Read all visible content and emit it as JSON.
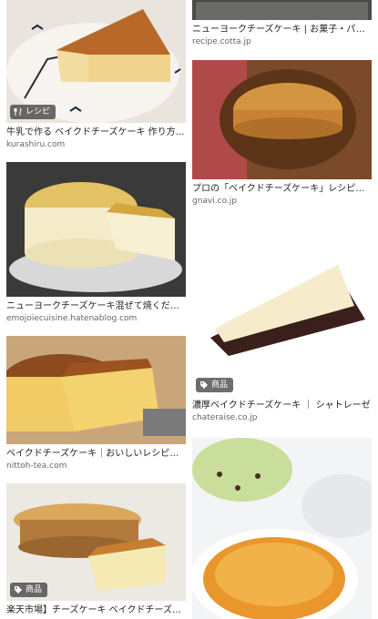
{
  "results": {
    "left": [
      {
        "title": "牛乳で作る ベイクドチーズケーキ 作り方・...",
        "source": "kurashiru.com",
        "badge": "レシピ",
        "badge_icon": "fork-knife-icon"
      },
      {
        "title": "ニューヨークチーズケーキ混ぜて焼くだけ...",
        "source": "emojoiecuisine.hatenablog.com"
      },
      {
        "title": "ベイクドチーズケーキ｜おいしいレシピ情...",
        "source": "nittoh-tea.com"
      },
      {
        "title": "楽天市場】チーズケーキ ベイクドチーズケ...",
        "source": "",
        "badge": "商品",
        "badge_icon": "tag-icon"
      }
    ],
    "right": [
      {
        "title": "ニューヨークチーズケーキ | お菓子・パン...",
        "source": "recipe.cotta.jp"
      },
      {
        "title": "プロの「ベイクドチーズケーキ」レシピの...",
        "source": "gnavi.co.jp"
      },
      {
        "title": "濃厚ベイクドチーズケーキ ｜ シャトレーゼ",
        "source": "chateraise.co.jp",
        "badge": "商品",
        "badge_icon": "tag-icon"
      },
      {
        "title": "",
        "source": ""
      }
    ]
  }
}
